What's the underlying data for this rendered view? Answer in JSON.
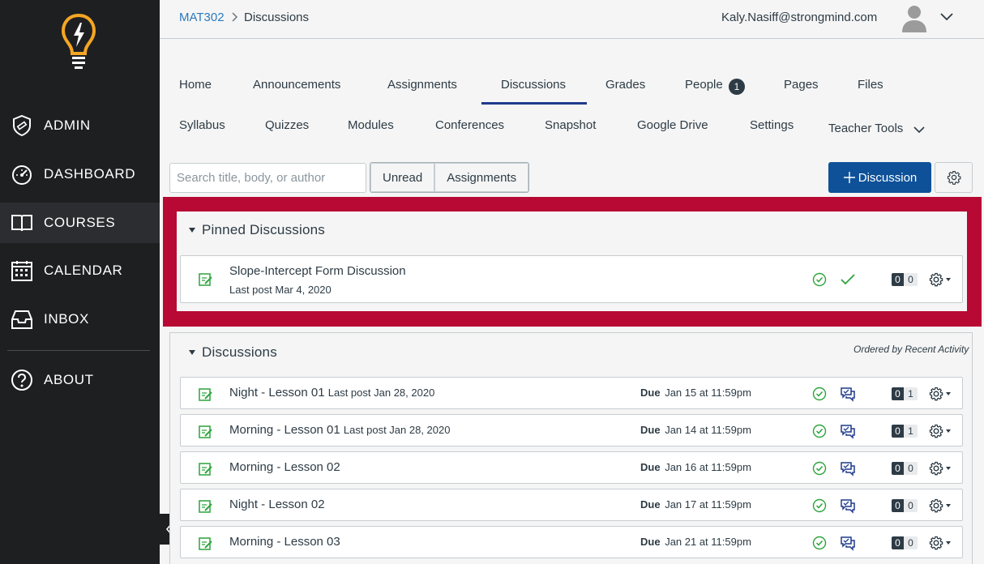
{
  "sidebar": {
    "items": [
      {
        "label": "ADMIN",
        "icon": "shield-icon"
      },
      {
        "label": "DASHBOARD",
        "icon": "dashboard-icon"
      },
      {
        "label": "COURSES",
        "icon": "book-icon"
      },
      {
        "label": "CALENDAR",
        "icon": "calendar-icon"
      },
      {
        "label": "INBOX",
        "icon": "inbox-icon"
      },
      {
        "label": "ABOUT",
        "icon": "help-icon"
      }
    ],
    "active": "COURSES",
    "logo_color": "#f5a623"
  },
  "header": {
    "breadcrumb_course": "MAT302",
    "breadcrumb_page": "Discussions",
    "user_email": "Kaly.Nasiff@strongmind.com"
  },
  "tabs": {
    "row1": [
      "Home",
      "Announcements",
      "Assignments",
      "Discussions",
      "Grades",
      "People",
      "Pages",
      "Files"
    ],
    "row2": [
      "Syllabus",
      "Quizzes",
      "Modules",
      "Conferences",
      "Snapshot",
      "Google Drive",
      "Settings",
      "Teacher Tools"
    ],
    "active": "Discussions",
    "people_badge": "1"
  },
  "toolbar": {
    "search_placeholder": "Search title, body, or author",
    "filter_unread": "Unread",
    "filter_assignments": "Assignments",
    "add_label": "Discussion",
    "add_color": "#0e5199"
  },
  "pinned": {
    "title": "Pinned Discussions",
    "highlight_color": "#b70934",
    "items": [
      {
        "title": "Slope-Intercept Form Discussion",
        "last_post": "Last post Mar 4, 2020",
        "read": "0",
        "unread": "0"
      }
    ]
  },
  "discussions": {
    "title": "Discussions",
    "ordered_by": "Ordered by Recent Activity",
    "due_label": "Due",
    "items": [
      {
        "title": "Night - Lesson 01",
        "last_post": "Last post Jan 28, 2020",
        "due": "Jan 15 at 11:59pm",
        "read": "0",
        "unread": "1"
      },
      {
        "title": "Morning - Lesson 01",
        "last_post": "Last post Jan 28, 2020",
        "due": "Jan 14 at 11:59pm",
        "read": "0",
        "unread": "1"
      },
      {
        "title": "Morning - Lesson 02",
        "last_post": "",
        "due": "Jan 16 at 11:59pm",
        "read": "0",
        "unread": "0"
      },
      {
        "title": "Night - Lesson 02",
        "last_post": "",
        "due": "Jan 17 at 11:59pm",
        "read": "0",
        "unread": "0"
      },
      {
        "title": "Morning - Lesson 03",
        "last_post": "",
        "due": "Jan 21 at 11:59pm",
        "read": "0",
        "unread": "0"
      }
    ]
  },
  "colors": {
    "published_green": "#2ca43a",
    "subscribe_blue": "#1f3b8c"
  }
}
